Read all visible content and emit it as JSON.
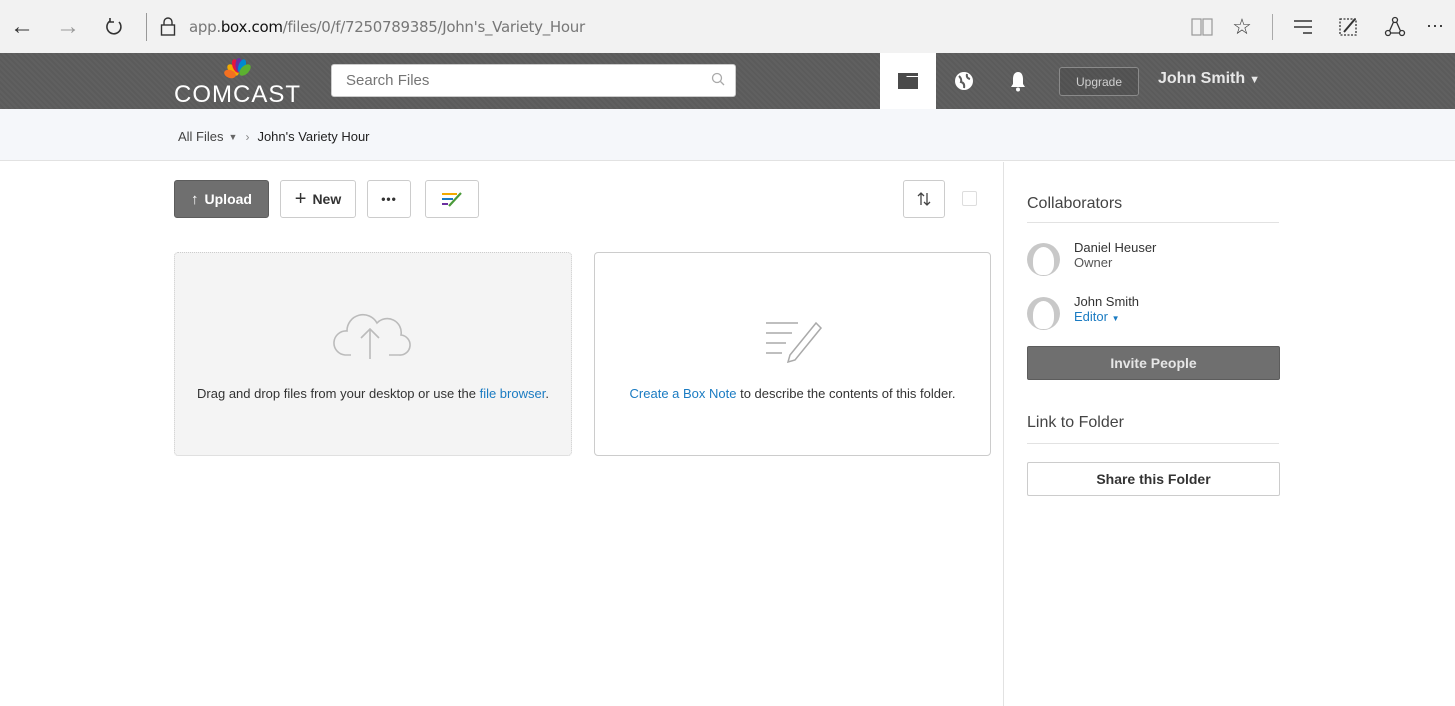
{
  "browser": {
    "url_prefix": "app.",
    "url_domain": "box.com",
    "url_path": "/files/0/f/7250789385/John's_Variety_Hour"
  },
  "header": {
    "logo_text": "COMCAST",
    "search_placeholder": "Search Files",
    "upgrade_label": "Upgrade",
    "user_name": "John Smith"
  },
  "breadcrumb": {
    "root": "All Files",
    "current": "John's Variety Hour"
  },
  "toolbar": {
    "upload_label": "Upload",
    "new_label": "New",
    "more_label": "•••"
  },
  "drop_card": {
    "text": "Drag and drop files from your desktop or use the ",
    "link": "file browser",
    "end": "."
  },
  "note_card": {
    "link": "Create a Box Note",
    "text": " to describe the contents of this folder."
  },
  "sidebar": {
    "collaborators_title": "Collaborators",
    "collaborators": [
      {
        "name": "Daniel Heuser",
        "role": "Owner"
      },
      {
        "name": "John Smith",
        "role": "Editor"
      }
    ],
    "invite_label": "Invite People",
    "link_title": "Link to Folder",
    "share_label": "Share this Folder"
  }
}
